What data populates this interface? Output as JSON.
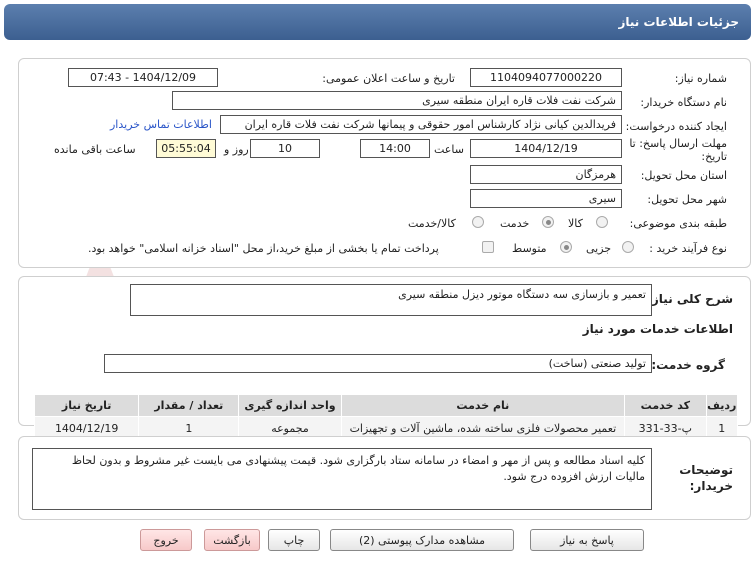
{
  "header": {
    "title": "جزئیات اطلاعات نیاز"
  },
  "fields": {
    "need_number_label": "شماره نیاز:",
    "need_number": "1104094077000220",
    "announce_label": "تاریخ و ساعت اعلان عمومی:",
    "announce_value": "1404/12/09 - 07:43",
    "buyer_org_label": "نام دستگاه خریدار:",
    "buyer_org": "شرکت نفت فلات قاره ایران منطقه سیری",
    "creator_label": "ایجاد کننده درخواست:",
    "creator": "فریدالدین کیانی نژاد کارشناس امور حقوقی و پیمانها شرکت نفت فلات قاره ایران",
    "contact_link": "اطلاعات تماس خریدار",
    "deadline_label": "مهلت ارسال پاسخ: تا تاریخ:",
    "deadline_date": "1404/12/19",
    "time_label": "ساعت",
    "deadline_time": "14:00",
    "days_label": "روز و",
    "days_value": "10",
    "remaining_value": "05:55:04",
    "remaining_label": "ساعت باقی مانده",
    "province_label": "استان محل تحویل:",
    "province": "هرمزگان",
    "city_label": "شهر محل تحویل:",
    "city": "سیری",
    "category_label": "طبقه بندی موضوعی:",
    "category_options": [
      "کالا",
      "خدمت",
      "کالا/خدمت"
    ],
    "process_label": "نوع فرآیند خرید :",
    "process_options": [
      "جزیی",
      "متوسط"
    ],
    "payment_note": "پرداخت تمام یا بخشی از مبلغ خرید،از محل \"اسناد خزانه اسلامی\" خواهد بود."
  },
  "summary": {
    "label": "شرح کلی نیاز:",
    "value": "تعمیر و بازسازی سه دستگاه موتور دیزل منطقه سیری"
  },
  "services": {
    "section_title": "اطلاعات خدمات مورد نیاز",
    "group_label": "گروه خدمت:",
    "group_value": "تولید صنعتی (ساخت)",
    "columns": [
      "ردیف",
      "کد خدمت",
      "نام خدمت",
      "واحد اندازه گیری",
      "تعداد / مقدار",
      "تاریخ نیاز"
    ],
    "rows": [
      [
        "1",
        "پ-33-331",
        "تعمیر محصولات فلزی ساخته شده، ماشین آلات و تجهیزات",
        "مجموعه",
        "1",
        "1404/12/19"
      ]
    ]
  },
  "buyer_notes": {
    "label": "توضیحات خریدار:",
    "value": "کلیه اسناد مطالعه و پس از مهر و امضاء در سامانه ستاد بارگزاری شود. قیمت پیشنهادی می بایست غیر مشروط و بدون لحاظ مالیات ارزش افزوده درج شود."
  },
  "buttons": {
    "reply": "پاسخ به نیاز",
    "attachments": "مشاهده مدارک پیوستی (2)",
    "print": "چاپ",
    "back": "بازگشت",
    "exit": "خروج"
  },
  "colors": {
    "header": "#4a6da0",
    "link": "#2a55c8",
    "highlight": "#fffbd6"
  }
}
